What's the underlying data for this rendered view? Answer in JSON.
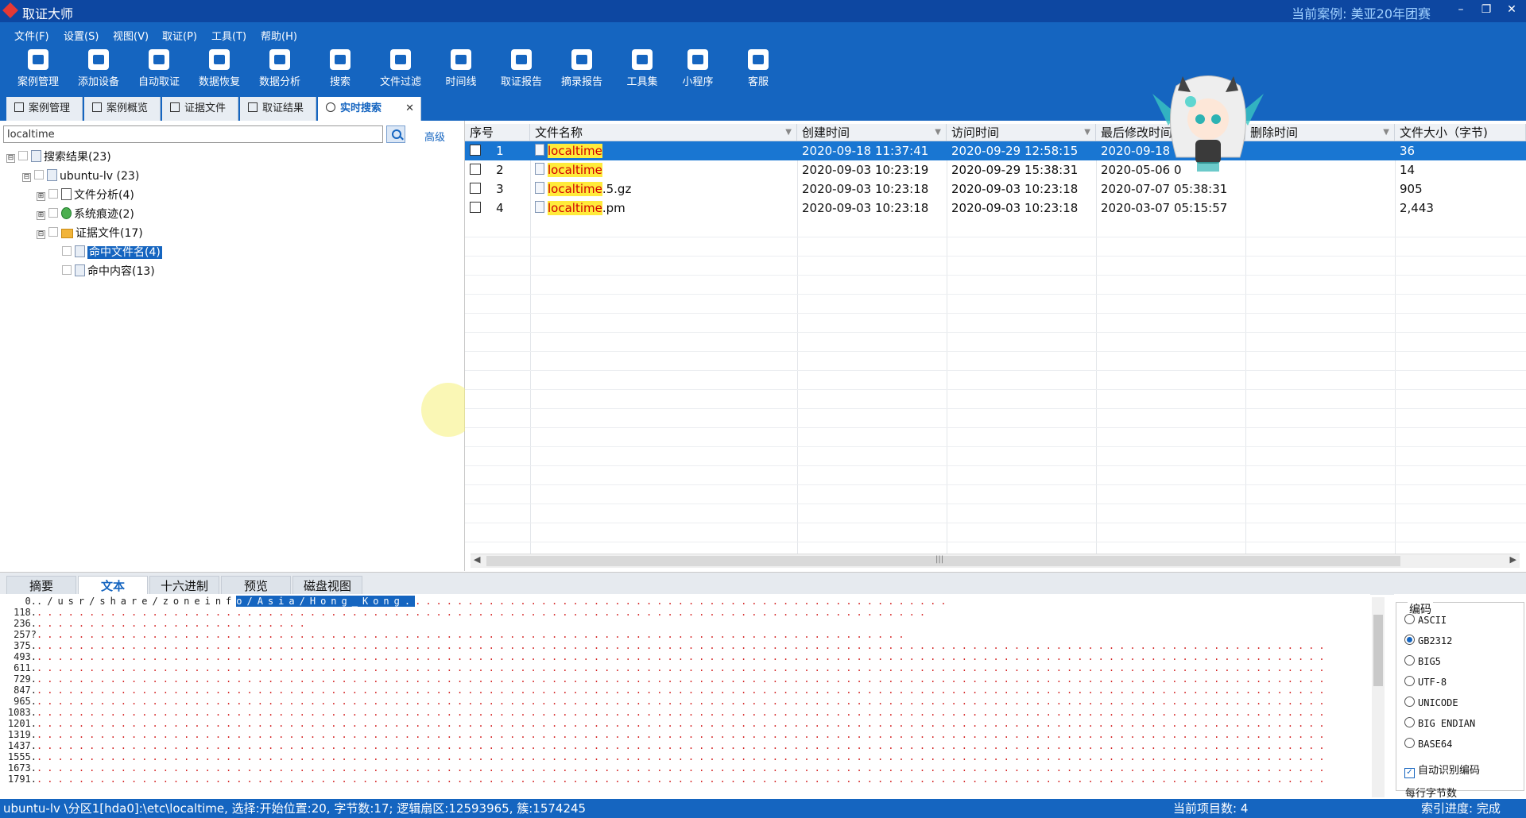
{
  "window": {
    "title": "取证大师",
    "current_case": "当前案例:  美亚20年团赛",
    "min_glyph": "–",
    "max_glyph": "❐",
    "close_glyph": "✕"
  },
  "menu": [
    "文件(F)",
    "设置(S)",
    "视图(V)",
    "取证(P)",
    "工具(T)",
    "帮助(H)"
  ],
  "toolbar": [
    {
      "label": "案例管理",
      "icon": "case-icon"
    },
    {
      "label": "添加设备",
      "icon": "add-device-icon"
    },
    {
      "label": "自动取证",
      "icon": "auto-icon"
    },
    {
      "label": "数据恢复",
      "icon": "recover-icon"
    },
    {
      "label": "数据分析",
      "icon": "analysis-icon"
    },
    {
      "label": "搜索",
      "icon": "search-icon"
    },
    {
      "label": "文件过滤",
      "icon": "filter-icon"
    },
    {
      "label": "时间线",
      "icon": "timeline-icon"
    },
    {
      "label": "取证报告",
      "icon": "report-icon"
    },
    {
      "label": "摘录报告",
      "icon": "excerpt-icon"
    },
    {
      "label": "工具集",
      "icon": "tools-icon"
    },
    {
      "label": "小程序",
      "icon": "miniapp-icon"
    },
    {
      "label": "客服",
      "icon": "support-icon"
    }
  ],
  "tabs": [
    "案例管理",
    "案例概览",
    "证据文件",
    "取证结果",
    "实时搜索"
  ],
  "tab_close_glyph": "✕",
  "search": {
    "value": "localtime",
    "advanced": "高级"
  },
  "tree": [
    {
      "label": "搜索结果(23)",
      "expander": "⊟"
    },
    {
      "label": "ubuntu-lv (23)",
      "expander": "⊟"
    },
    {
      "label": "文件分析(4)",
      "expander": "⊞"
    },
    {
      "label": "系统痕迹(2)",
      "expander": "⊞"
    },
    {
      "label": "证据文件(17)",
      "expander": "⊟"
    },
    {
      "label": "命中文件名(4)",
      "expander": ""
    },
    {
      "label": "命中内容(13)",
      "expander": ""
    }
  ],
  "grid": {
    "headers": [
      "序号",
      "文件名称",
      "创建时间",
      "访问时间",
      "最后修改时间",
      "删除时间",
      "文件大小（字节)"
    ],
    "rows": [
      {
        "no": "1",
        "hit": "localtime",
        "rest": "",
        "created": "2020-09-18 11:37:41",
        "accessed": "2020-09-29 12:58:15",
        "modified": "2020-09-18",
        "deleted": "",
        "size": "36"
      },
      {
        "no": "2",
        "hit": "localtime",
        "rest": "",
        "created": "2020-09-03 10:23:19",
        "accessed": "2020-09-29 15:38:31",
        "modified": "2020-05-06 0",
        "deleted": "",
        "size": "14"
      },
      {
        "no": "3",
        "hit": "localtime",
        "rest": ".5.gz",
        "created": "2020-09-03 10:23:18",
        "accessed": "2020-09-03 10:23:18",
        "modified": "2020-07-07 05:38:31",
        "deleted": "",
        "size": "905"
      },
      {
        "no": "4",
        "hit": "localtime",
        "rest": ".pm",
        "created": "2020-09-03 10:23:18",
        "accessed": "2020-09-03 10:23:18",
        "modified": "2020-03-07 05:15:57",
        "deleted": "",
        "size": "2,443"
      }
    ],
    "filter_glyph": "▼",
    "scroll_left": "◀",
    "scroll_right": "▶",
    "scroll_mid": "|||"
  },
  "bottom_tabs": [
    "摘要",
    "文本",
    "十六进制",
    "预览",
    "磁盘视图"
  ],
  "textview": {
    "lines": [
      {
        "offset": "0.",
        "pre": "./usr/share/zoneinf",
        "sel": "o/Asia/Hong_Kong.",
        "post": "...................................................",
        "mid": "",
        "tail": ""
      },
      {
        "offset": "118.",
        "pre": "",
        "sel": "",
        "post": ".....................................................................................",
        "mid": "",
        "tail": ""
      },
      {
        "offset": "236.",
        "pre": "",
        "sel": "",
        "post": "..........................",
        "mid": "",
        "tail": ""
      },
      {
        "offset": "257?",
        "pre": "",
        "sel": "",
        "post": "...................................................................................",
        "mid": "",
        "tail": ""
      },
      {
        "offset": "375.",
        "pre": "",
        "sel": "",
        "post": "...........................................................................................................................",
        "mid": "",
        "tail": ""
      },
      {
        "offset": "493.",
        "pre": "",
        "sel": "",
        "post": "...........................................................................................................................",
        "mid": "",
        "tail": ""
      },
      {
        "offset": "611.",
        "pre": "",
        "sel": "",
        "post": "...........................................................................................................................",
        "mid": "",
        "tail": ""
      },
      {
        "offset": "729.",
        "pre": "",
        "sel": "",
        "post": "...........................................................................................................................",
        "mid": "",
        "tail": ""
      },
      {
        "offset": "847.",
        "pre": "",
        "sel": "",
        "post": "...........................................................................................................................",
        "mid": "",
        "tail": ""
      },
      {
        "offset": "965.",
        "pre": "",
        "sel": "",
        "post": "...........................................................................................................................",
        "mid": "",
        "tail": ""
      },
      {
        "offset": "1083.",
        "pre": "",
        "sel": "",
        "post": "...........................................................................................................................",
        "mid": "",
        "tail": ""
      },
      {
        "offset": "1201.",
        "pre": "",
        "sel": "",
        "post": "...........................................................................................................................",
        "mid": "",
        "tail": ""
      },
      {
        "offset": "1319.",
        "pre": "",
        "sel": "",
        "post": "...........................................................................................................................",
        "mid": "",
        "tail": ""
      },
      {
        "offset": "1437.",
        "pre": "",
        "sel": "",
        "post": "...........................................................................................................................",
        "mid": "",
        "tail": ""
      },
      {
        "offset": "1555.",
        "pre": "",
        "sel": "",
        "post": "...........................................................................................................................",
        "mid": "",
        "tail": ""
      },
      {
        "offset": "1673.",
        "pre": "",
        "sel": "",
        "post": "...........................................................................................................................",
        "mid": "",
        "tail": ""
      },
      {
        "offset": "1791.",
        "pre": "",
        "sel": "",
        "post": "...........................................................................................................................",
        "mid": "",
        "tail": ""
      }
    ]
  },
  "encoding": {
    "legend": "编码",
    "options": [
      "ASCII",
      "GB2312",
      "BIG5",
      "UTF-8",
      "UNICODE",
      "BIG ENDIAN",
      "BASE64"
    ],
    "selected": 1,
    "auto_detect": "自动识别编码",
    "bytes_per_line": "每行字节数",
    "check_glyph": "✓"
  },
  "statusbar": {
    "path": "ubuntu-lv \\分区1[hda0]:\\etc\\localtime, 选择:开始位置:20, 字节数:17; 逻辑扇区:12593965, 簇:1574245",
    "count": "当前项目数: 4",
    "progress": "索引进度: 完成"
  },
  "colors": {
    "titlebar": "#0d47a1",
    "menubar": "#1565c0",
    "selection": "#1976d2",
    "highlight": "#ffeb3b"
  }
}
